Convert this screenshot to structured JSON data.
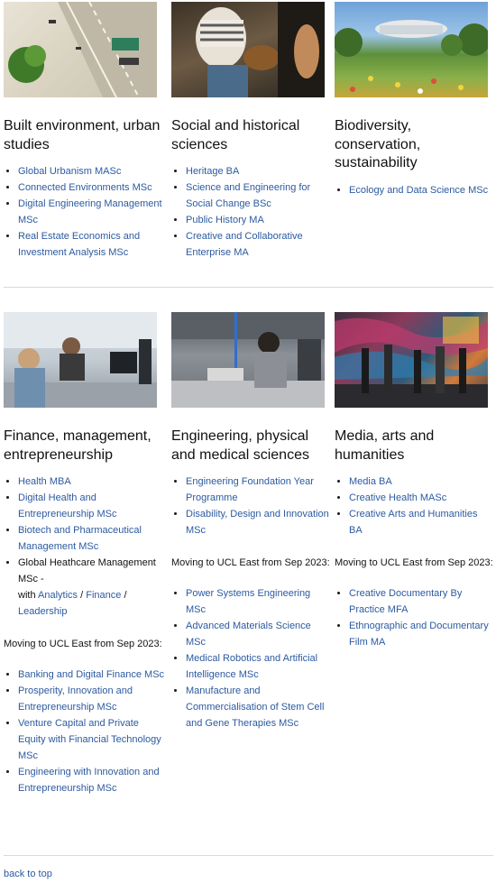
{
  "sections": {
    "built": {
      "image_alt": "",
      "title": "Built environment, urban studies",
      "links": [
        "Global Urbanism MASc",
        "Connected Environments MSc",
        "Digital Engineering Management MSc",
        "Real Estate Economics and Investment Analysis MSc"
      ]
    },
    "social": {
      "title": "Social and historical sciences",
      "links": [
        "Heritage BA",
        "Science and Engineering for Social Change BSc",
        "Public History MA",
        "Creative and Collaborative Enterprise MA"
      ]
    },
    "bio": {
      "title": "Biodiversity, conservation, sustainability",
      "links": [
        "Ecology and Data Science MSc"
      ]
    },
    "finance": {
      "title": "Finance, management, entrepreneurship",
      "links": [
        "Health MBA",
        "Digital Health and Entrepreneurship MSc",
        "Biotech and Pharmaceutical Management MSc"
      ],
      "global_item": "Global Heathcare Management MSc -",
      "with_text": "with",
      "global_links": [
        "Analytics",
        "Finance",
        "Leadership"
      ],
      "sep": "/",
      "moving_note": "Moving to UCL East from Sep 2023:",
      "moving_links": [
        "Banking and Digital Finance MSc",
        "Prosperity, Innovation and Entrepreneurship MSc",
        "Venture Capital and Private Equity with Financial Technology MSc",
        "Engineering with Innovation and Entrepreneurship MSc"
      ]
    },
    "engineering": {
      "title": "Engineering, physical and medical sciences",
      "links": [
        "Engineering Foundation Year Programme",
        "Disability, Design and Innovation MSc"
      ],
      "moving_note": "Moving to UCL East from Sep 2023:",
      "moving_links": [
        "Power Systems Engineering MSc",
        "Advanced Materials Science MSc",
        "Medical Robotics and Artificial Intelligence MSc",
        "Manufacture and Commercialisation of Stem Cell and Gene Therapies MSc"
      ]
    },
    "media": {
      "title": "Media, arts and humanities",
      "links": [
        "Media BA",
        "Creative Health MASc",
        "Creative Arts and Humanities BA"
      ],
      "moving_note": "Moving to UCL East from Sep 2023:",
      "moving_links": [
        "Creative Documentary By Practice MFA",
        "Ethnographic and Documentary Film MA"
      ]
    }
  },
  "back_to_top": "back to top",
  "colors": {
    "link": "#2c5aa0",
    "divider": "#d9d9d9"
  }
}
